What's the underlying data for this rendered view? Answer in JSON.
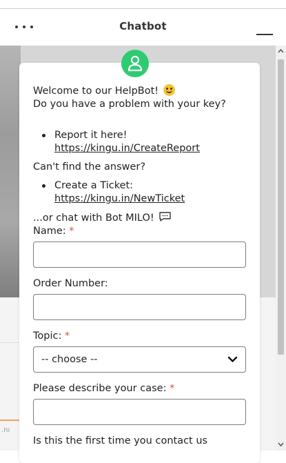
{
  "header": {
    "title": "Chatbot"
  },
  "welcome": {
    "line1": "Welcome to our HelpBot!",
    "line2": "Do you have a problem with your key?"
  },
  "report": {
    "label": "Report it here!",
    "link": "https://kingu.in/CreateReport"
  },
  "cant_find": "Can't find the answer?",
  "ticket": {
    "label": "Create a Ticket:",
    "link": "https://kingu.in/NewTicket"
  },
  "chat_with": "...or chat with Bot MILO!",
  "form": {
    "name_label": "Name:",
    "order_label": "Order Number:",
    "topic_label": "Topic:",
    "topic_selected": "-- choose --",
    "describe_label": "Please describe your case:",
    "first_time_label": "Is this the first time you contact us",
    "required_mark": "*"
  },
  "background": {
    "partial_text": ".nı"
  },
  "colors": {
    "avatar": "#2ecc71",
    "required": "#e04a3f",
    "accent_bar": "#f0a35c"
  },
  "icons": {
    "menu": "more-dots-icon",
    "minimize": "minimize-icon",
    "avatar": "user-icon",
    "emoji": "smiley-emoji-icon",
    "chat": "speech-bubble-icon",
    "select": "chevron-down-icon"
  }
}
